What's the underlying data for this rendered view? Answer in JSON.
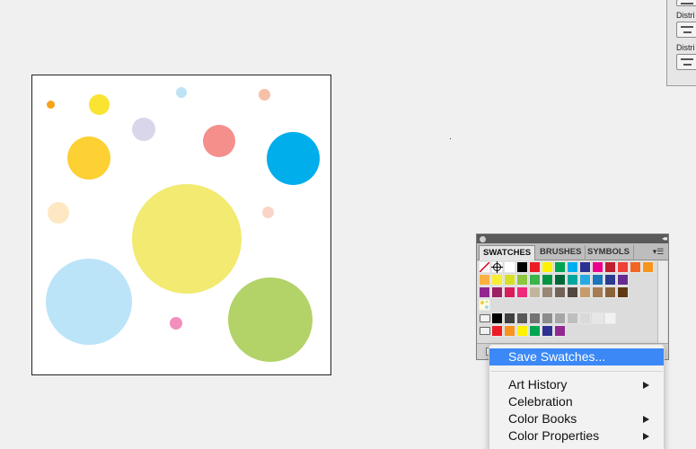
{
  "artboard": {
    "background": "#ffffff"
  },
  "align_panel": {
    "labels": [
      "Distri",
      "Distri"
    ]
  },
  "swatches_panel": {
    "tabs": [
      {
        "label": "SWATCHES",
        "active": true
      },
      {
        "label": "BRUSHES",
        "active": false
      },
      {
        "label": "SYMBOLS",
        "active": false
      }
    ],
    "menu_icon": "panel-menu-icon",
    "row1": [
      "#ffffff",
      "#000000",
      "#ed1c24",
      "#fff200",
      "#00a651",
      "#00aeef",
      "#2e3192",
      "#ec008c",
      "#be1e2d",
      "#ef4136",
      "#f26522",
      "#f7941d"
    ],
    "row2": [
      "#fbb040",
      "#f9ed32",
      "#d7df23",
      "#8dc63f",
      "#39b54a",
      "#009444",
      "#006838",
      "#00a79d",
      "#27aae1",
      "#1c75bc",
      "#2b3990",
      "#662d91"
    ],
    "row3": [
      "#92278f",
      "#9e1f63",
      "#da1c5c",
      "#ee2a7b",
      "#c2b59b",
      "#998675",
      "#736357",
      "#534741",
      "#c69c6d",
      "#a67c52",
      "#8c6239",
      "#603913"
    ],
    "grays": [
      "#000000",
      "#404040",
      "#595959",
      "#737373",
      "#8c8c8c",
      "#a6a6a6",
      "#bfbfbf",
      "#d9d9d9",
      "#e6e6e6",
      "#f2f2f2"
    ],
    "brights": [
      "#ed1c24",
      "#f7941d",
      "#fff200",
      "#00a651",
      "#2e3192",
      "#92278f"
    ]
  },
  "menu": {
    "items": [
      {
        "label": "Save Swatches...",
        "submenu": false,
        "highlight": true
      },
      {
        "label": "Art History",
        "submenu": true,
        "highlight": false
      },
      {
        "label": "Celebration",
        "submenu": false,
        "highlight": false
      },
      {
        "label": "Color Books",
        "submenu": true,
        "highlight": false
      },
      {
        "label": "Color Properties",
        "submenu": true,
        "highlight": false
      }
    ],
    "highlight_color": "#3b88f6"
  }
}
